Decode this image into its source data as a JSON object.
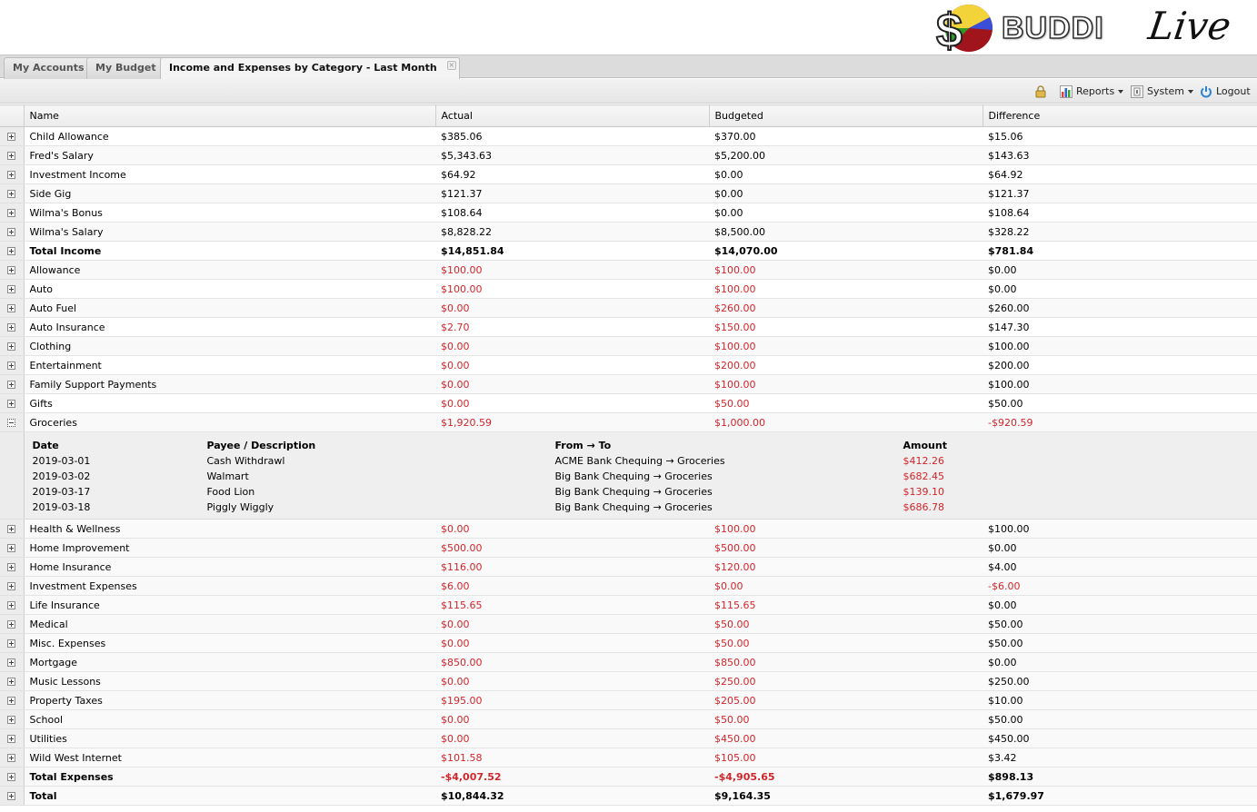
{
  "app": {
    "logo_word": "BUDDI",
    "logo_live": "Live",
    "logo_colors": {
      "yellow": "#f2d43a",
      "blue": "#3a4fd6",
      "red": "#a0141c",
      "green": "#2f9a2a"
    }
  },
  "tabs": [
    {
      "label": "My Accounts",
      "active": false
    },
    {
      "label": "My Budget",
      "active": false
    },
    {
      "label": "Income and Expenses by Category - Last Month",
      "active": true,
      "closable": true
    }
  ],
  "toolbar": {
    "lock_icon": "lock-icon",
    "reports_label": "Reports",
    "system_label": "System",
    "logout_label": "Logout"
  },
  "columns": {
    "name": "Name",
    "actual": "Actual",
    "budgeted": "Budgeted",
    "difference": "Difference"
  },
  "colors": {
    "negative": "#d0262b"
  },
  "income_rows": [
    {
      "name": "Child Allowance",
      "actual": "$385.06",
      "budgeted": "$370.00",
      "difference": "$15.06"
    },
    {
      "name": "Fred's Salary",
      "actual": "$5,343.63",
      "budgeted": "$5,200.00",
      "difference": "$143.63"
    },
    {
      "name": "Investment Income",
      "actual": "$64.92",
      "budgeted": "$0.00",
      "difference": "$64.92"
    },
    {
      "name": "Side Gig",
      "actual": "$121.37",
      "budgeted": "$0.00",
      "difference": "$121.37"
    },
    {
      "name": "Wilma's Bonus",
      "actual": "$108.64",
      "budgeted": "$0.00",
      "difference": "$108.64"
    },
    {
      "name": "Wilma's Salary",
      "actual": "$8,828.22",
      "budgeted": "$8,500.00",
      "difference": "$328.22"
    }
  ],
  "total_income": {
    "name": "Total Income",
    "actual": "$14,851.84",
    "budgeted": "$14,070.00",
    "difference": "$781.84"
  },
  "expense_rows_a": [
    {
      "name": "Allowance",
      "actual": "$100.00",
      "budgeted": "$100.00",
      "difference": "$0.00"
    },
    {
      "name": "Auto",
      "actual": "$100.00",
      "budgeted": "$100.00",
      "difference": "$0.00"
    },
    {
      "name": "Auto Fuel",
      "actual": "$0.00",
      "budgeted": "$260.00",
      "difference": "$260.00"
    },
    {
      "name": "Auto Insurance",
      "actual": "$2.70",
      "budgeted": "$150.00",
      "difference": "$147.30"
    },
    {
      "name": "Clothing",
      "actual": "$0.00",
      "budgeted": "$100.00",
      "difference": "$100.00"
    },
    {
      "name": "Entertainment",
      "actual": "$0.00",
      "budgeted": "$200.00",
      "difference": "$200.00"
    },
    {
      "name": "Family Support Payments",
      "actual": "$0.00",
      "budgeted": "$100.00",
      "difference": "$100.00"
    },
    {
      "name": "Gifts",
      "actual": "$0.00",
      "budgeted": "$50.00",
      "difference": "$50.00"
    }
  ],
  "expanded_row": {
    "name": "Groceries",
    "actual": "$1,920.59",
    "budgeted": "$1,000.00",
    "difference": "-$920.59",
    "detail_headers": {
      "date": "Date",
      "payee": "Payee / Description",
      "from_to": "From → To",
      "amount": "Amount"
    },
    "transactions": [
      {
        "date": "2019-03-01",
        "payee": "Cash Withdrawl",
        "from_to": "ACME Bank Chequing → Groceries",
        "amount": "$412.26"
      },
      {
        "date": "2019-03-02",
        "payee": "Walmart",
        "from_to": "Big Bank Chequing → Groceries",
        "amount": "$682.45"
      },
      {
        "date": "2019-03-17",
        "payee": "Food Lion",
        "from_to": "Big Bank Chequing → Groceries",
        "amount": "$139.10"
      },
      {
        "date": "2019-03-18",
        "payee": "Piggly Wiggly",
        "from_to": "Big Bank Chequing → Groceries",
        "amount": "$686.78"
      }
    ]
  },
  "expense_rows_b": [
    {
      "name": "Health & Wellness",
      "actual": "$0.00",
      "budgeted": "$100.00",
      "difference": "$100.00"
    },
    {
      "name": "Home Improvement",
      "actual": "$500.00",
      "budgeted": "$500.00",
      "difference": "$0.00"
    },
    {
      "name": "Home Insurance",
      "actual": "$116.00",
      "budgeted": "$120.00",
      "difference": "$4.00"
    },
    {
      "name": "Investment Expenses",
      "actual": "$6.00",
      "budgeted": "$0.00",
      "difference": "-$6.00"
    },
    {
      "name": "Life Insurance",
      "actual": "$115.65",
      "budgeted": "$115.65",
      "difference": "$0.00"
    },
    {
      "name": "Medical",
      "actual": "$0.00",
      "budgeted": "$50.00",
      "difference": "$50.00"
    },
    {
      "name": "Misc. Expenses",
      "actual": "$0.00",
      "budgeted": "$50.00",
      "difference": "$50.00"
    },
    {
      "name": "Mortgage",
      "actual": "$850.00",
      "budgeted": "$850.00",
      "difference": "$0.00"
    },
    {
      "name": "Music Lessons",
      "actual": "$0.00",
      "budgeted": "$250.00",
      "difference": "$250.00"
    },
    {
      "name": "Property Taxes",
      "actual": "$195.00",
      "budgeted": "$205.00",
      "difference": "$10.00"
    },
    {
      "name": "School",
      "actual": "$0.00",
      "budgeted": "$50.00",
      "difference": "$50.00"
    },
    {
      "name": "Utilities",
      "actual": "$0.00",
      "budgeted": "$450.00",
      "difference": "$450.00"
    },
    {
      "name": "Wild West Internet",
      "actual": "$101.58",
      "budgeted": "$105.00",
      "difference": "$3.42"
    }
  ],
  "total_expenses": {
    "name": "Total Expenses",
    "actual": "-$4,007.52",
    "budgeted": "-$4,905.65",
    "difference": "$898.13"
  },
  "total": {
    "name": "Total",
    "actual": "$10,844.32",
    "budgeted": "$9,164.35",
    "difference": "$1,679.97"
  }
}
